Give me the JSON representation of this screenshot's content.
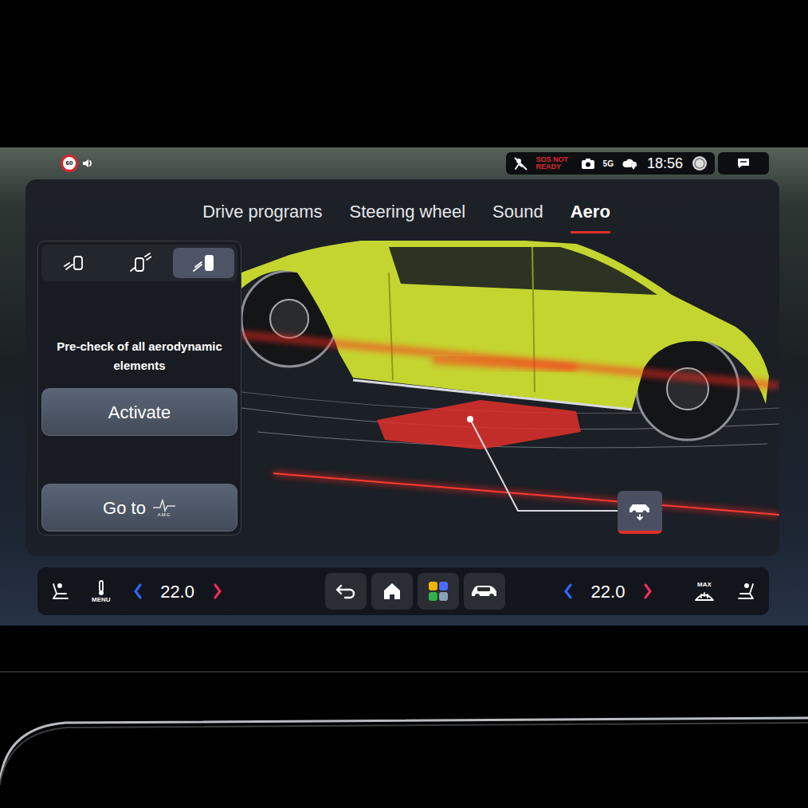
{
  "status_bar": {
    "speed_limit": "60",
    "sos": "SOS NOT READY",
    "network": "5G",
    "time": "18:56"
  },
  "tabs": [
    {
      "label": "Drive programs",
      "selected": false
    },
    {
      "label": "Steering wheel",
      "selected": false
    },
    {
      "label": "Sound",
      "selected": false
    },
    {
      "label": "Aero",
      "selected": true
    }
  ],
  "aero_modes": [
    {
      "selected": false
    },
    {
      "selected": false
    },
    {
      "selected": true
    }
  ],
  "aero_panel": {
    "description": "Pre-check of all aerodynamic elements",
    "activate_button": "Activate",
    "goto_button": "Go to",
    "goto_logo": "AMG"
  },
  "diagram": {
    "callout_active": true
  },
  "climate": {
    "menu_label": "MENU",
    "left_temperature": "22.0",
    "right_temperature": "22.0",
    "defrost_label": "MAX"
  }
}
